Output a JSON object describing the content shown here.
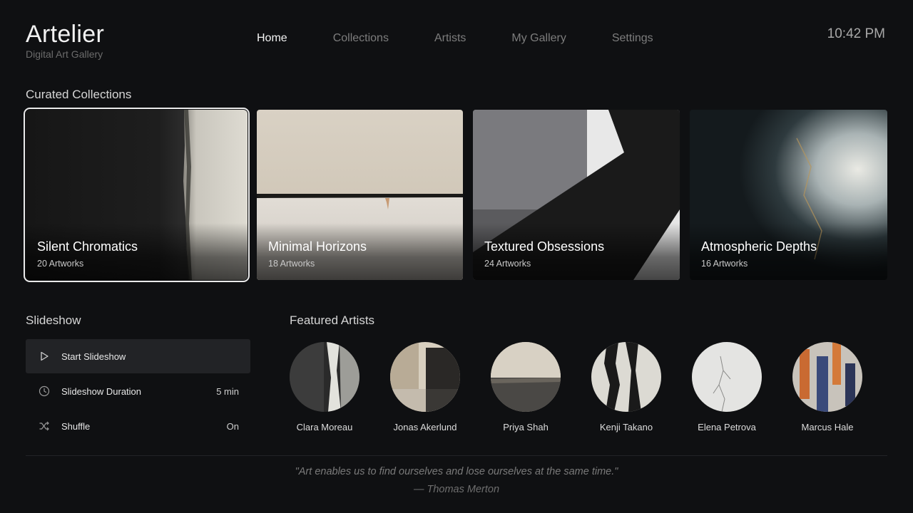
{
  "app": {
    "name": "Artelier",
    "subtitle": "Digital Art Gallery"
  },
  "nav": {
    "items": [
      "Home",
      "Collections",
      "Artists",
      "My Gallery",
      "Settings"
    ],
    "active": "Home"
  },
  "clock": "10:42 PM",
  "collections": {
    "title": "Curated Collections",
    "items": [
      {
        "title": "Silent Chromatics",
        "count": "20 Artworks",
        "focused": true
      },
      {
        "title": "Minimal Horizons",
        "count": "18 Artworks"
      },
      {
        "title": "Textured Obsessions",
        "count": "24 Artworks"
      },
      {
        "title": "Atmospheric Depths",
        "count": "16 Artworks"
      }
    ]
  },
  "slideshow": {
    "title": "Slideshow",
    "start": {
      "label": "Start Slideshow",
      "icon": "play-icon"
    },
    "duration": {
      "label": "Slideshow Duration",
      "value": "5 min",
      "icon": "clock-icon"
    },
    "shuffle": {
      "label": "Shuffle",
      "value": "On",
      "icon": "shuffle-icon"
    }
  },
  "featured_artists": {
    "title": "Featured Artists",
    "items": [
      {
        "name": "Clara Moreau"
      },
      {
        "name": "Jonas Akerlund"
      },
      {
        "name": "Priya Shah"
      },
      {
        "name": "Kenji Takano"
      },
      {
        "name": "Elena Petrova"
      },
      {
        "name": "Marcus Hale"
      }
    ]
  },
  "quote": {
    "text": "\"Art enables us to find ourselves and lose ourselves at the same time.\"",
    "author": "— Thomas Merton"
  }
}
